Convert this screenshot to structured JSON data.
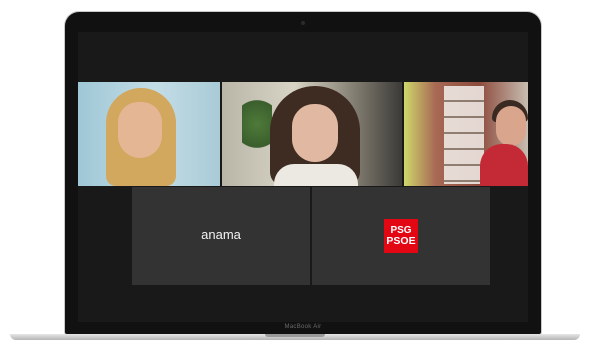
{
  "device": {
    "model_label": "MacBook Air"
  },
  "participants": [
    {
      "display": "video",
      "name": ""
    },
    {
      "display": "video",
      "name": ""
    },
    {
      "display": "video",
      "name": ""
    },
    {
      "display": "name",
      "name": "anama"
    },
    {
      "display": "logo",
      "name": "",
      "logo_lines": [
        "PSG",
        "PSOE"
      ]
    }
  ],
  "colors": {
    "meeting_background": "#191919",
    "tile_background": "#333333",
    "logo_red": "#e30613"
  }
}
